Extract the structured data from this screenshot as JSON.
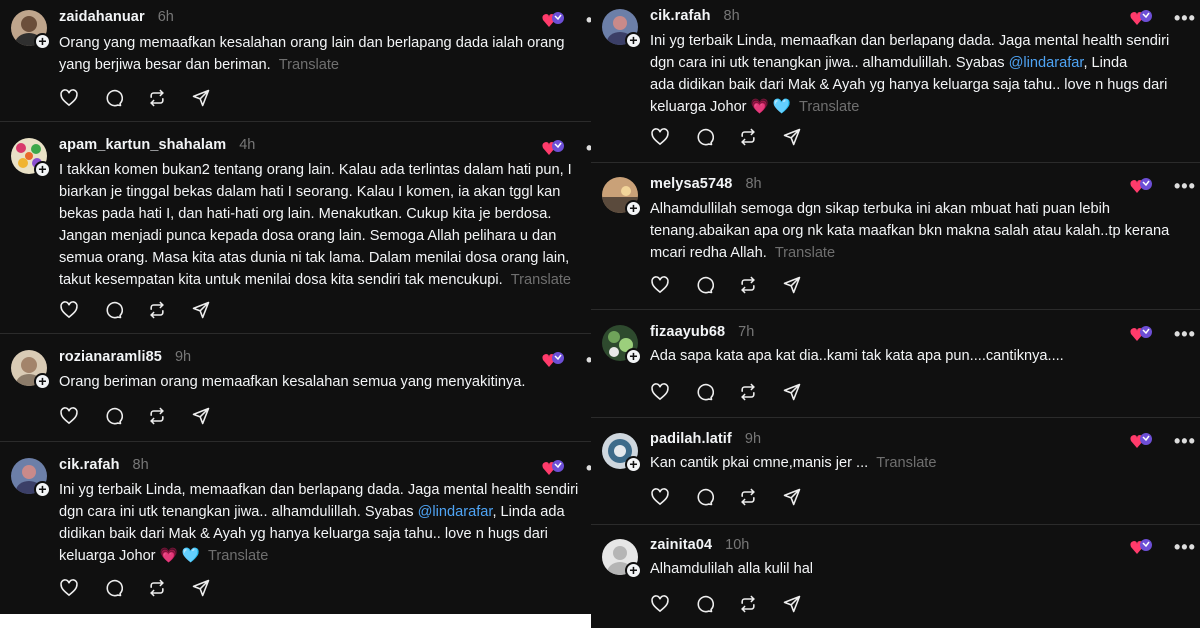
{
  "ui": {
    "translate_label": "Translate",
    "more_glyph": "•••"
  },
  "left_posts": [
    {
      "username": "zaidahanuar",
      "time": "6h",
      "lines": [
        "Orang yang memaafkan kesalahan orang lain dan berlapang dada ialah orang",
        "yang berjiwa besar dan beriman."
      ]
    },
    {
      "username": "apam_kartun_shahalam",
      "time": "4h",
      "lines": [
        "I takkan komen bukan2 tentang orang lain. Kalau ada terlintas dalam hati pun, I",
        "biarkan je tinggal bekas dalam hati I seorang. Kalau I komen, ia akan tggl kan",
        "bekas pada hati I, dan hati-hati org lain. Menakutkan. Cukup kita je berdosa.",
        "Jangan menjadi punca kepada dosa orang lain. Semoga Allah pelihara u dan",
        "semua orang. Masa kita atas dunia ni tak lama. Dalam menilai dosa orang lain,",
        "takut kesempatan kita untuk menilai dosa kita sendiri tak mencukupi."
      ]
    },
    {
      "username": "rozianaramli85",
      "time": "9h",
      "lines": [
        "Orang beriman orang memaafkan kesalahan semua yang menyakitinya."
      ]
    },
    {
      "username": "cik.rafah",
      "time": "8h",
      "lines": [
        "Ini yg terbaik Linda, memaafkan dan berlapang dada. Jaga mental health sendiri",
        "dgn cara ini utk tenangkan jiwa.. alhamdulillah. Syabas ",
        "didikan baik dari Mak & Ayah yg hanya keluarga saja tahu.. love n hugs dari",
        "keluarga Johor "
      ],
      "mention": "@lindarafar",
      "after_mention": ", Linda ada",
      "emojis": "💗 🩵"
    }
  ],
  "right_posts": [
    {
      "username": "cik.rafah",
      "time": "8h",
      "lines": [
        "Ini yg terbaik Linda, memaafkan dan berlapang dada. Jaga mental health sendiri",
        "dgn cara ini utk tenangkan jiwa.. alhamdulillah. Syabas ",
        "ada didikan baik dari Mak & Ayah yg hanya keluarga saja tahu.. love n hugs dari",
        "keluarga Johor "
      ],
      "mention": "@lindarafar",
      "after_mention": ", Linda",
      "emojis": "💗 🩵"
    },
    {
      "username": "melysa5748",
      "time": "8h",
      "lines": [
        "Alhamdullilah semoga dgn sikap terbuka ini akan mbuat hati puan lebih",
        "tenang.abaikan apa org nk kata maafkan bkn makna salah atau kalah..tp kerana",
        "mcari redha Allah."
      ]
    },
    {
      "username": "fizaayub68",
      "time": "7h",
      "lines": [
        "Ada sapa kata apa kat dia..kami tak kata apa pun....cantiknya...."
      ]
    },
    {
      "username": "padilah.latif",
      "time": "9h",
      "lines": [
        "Kan cantik pkai cmne,manis jer ..."
      ]
    },
    {
      "username": "zainita04",
      "time": "10h",
      "lines": [
        "Alhamdulilah alla kulil hal"
      ]
    }
  ],
  "colors": {
    "background": "#101010",
    "divider": "#2b2b2b",
    "text": "#f3f5f7",
    "muted": "#777777",
    "mention": "#4fa4f4"
  },
  "icons": [
    "like-icon",
    "comment-icon",
    "repost-icon",
    "share-icon",
    "more-icon",
    "follow-plus-icon",
    "emoji-badge-icon"
  ]
}
